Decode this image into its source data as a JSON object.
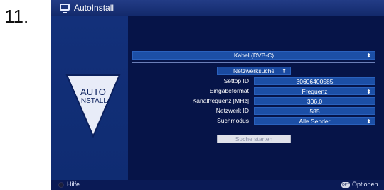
{
  "step": {
    "number": "11."
  },
  "title": {
    "text": "AutoInstall"
  },
  "logo": {
    "line1": "AUTO",
    "line2": "INSTALL"
  },
  "source": {
    "value": "Kabel (DVB-C)"
  },
  "search_mode_button": {
    "label": "Netzwerksuche"
  },
  "fields": [
    {
      "label": "Settop ID",
      "value": "30606400585",
      "has_dropdown": false
    },
    {
      "label": "Eingabeformat",
      "value": "Frequenz",
      "has_dropdown": true
    },
    {
      "label": "Kanalfrequenz [MHz]",
      "value": "306.0",
      "has_dropdown": false
    },
    {
      "label": "Netzwerk ID",
      "value": "585",
      "has_dropdown": false
    },
    {
      "label": "Suchmodus",
      "value": "Alle Sender",
      "has_dropdown": true
    }
  ],
  "start_button": {
    "label": "Suche starten"
  },
  "footer": {
    "help": "Hilfe",
    "options_icon": "OPT",
    "options": "Optionen"
  },
  "colors": {
    "screen_bg": "#0a1f5c",
    "field_bg": "#1c4fa6",
    "start_button_bg": "#e0e2ea"
  },
  "icons": {
    "title": "tv-icon",
    "dropdown": "dropdown-arrow-icon",
    "help": "red-button-icon",
    "options": "opt-button-icon"
  }
}
